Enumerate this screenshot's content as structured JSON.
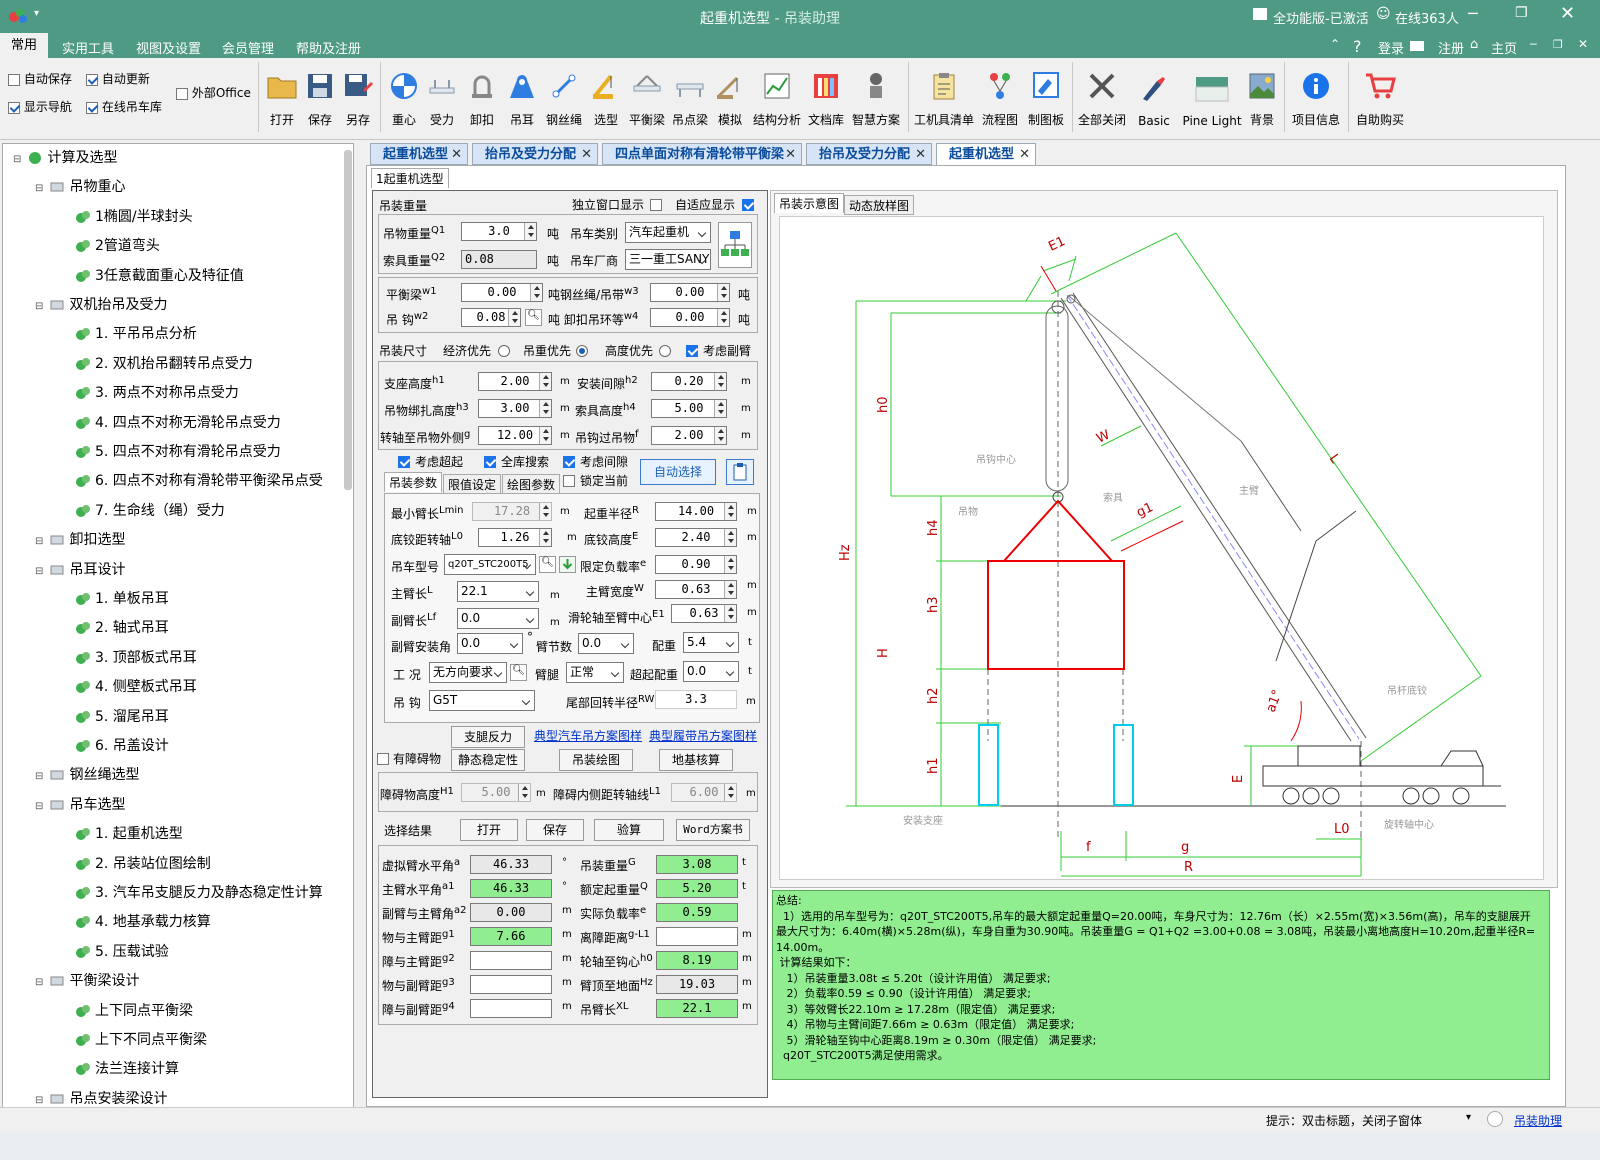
{
  "window": {
    "title_main": "起重机选型",
    "title_sep": " - ",
    "title_app": "吊装助理",
    "license": "全功能版-已激活",
    "online": "在线363人"
  },
  "menu": {
    "items": [
      "常用",
      "实用工具",
      "视图及设置",
      "会员管理",
      "帮助及注册"
    ],
    "login": "登录",
    "register": "注册",
    "home": "主页"
  },
  "ribbon": {
    "checks": [
      {
        "label": "自动保存",
        "checked": false
      },
      {
        "label": "自动更新",
        "checked": true
      },
      {
        "label": "外部Office",
        "checked": false
      },
      {
        "label": "显示导航",
        "checked": true
      },
      {
        "label": "在线吊车库",
        "checked": true
      }
    ],
    "buttons": [
      "打开",
      "保存",
      "另存",
      "重心",
      "受力",
      "卸扣",
      "吊耳",
      "钢丝绳",
      "选型",
      "平衡梁",
      "吊点梁",
      "模拟",
      "结构分析",
      "文档库",
      "智慧方案",
      "工机具清单",
      "流程图",
      "制图板",
      "全部关闭",
      "Basic",
      "Pine Light",
      "背景",
      "项目信息",
      "自助购买"
    ]
  },
  "tree": {
    "items": [
      {
        "label": "计算及选型",
        "level": 0
      },
      {
        "label": "吊物重心",
        "level": 1
      },
      {
        "label": "1椭圆/半球封头",
        "level": 2
      },
      {
        "label": "2管道弯头",
        "level": 2
      },
      {
        "label": "3任意截面重心及特征值",
        "level": 2
      },
      {
        "label": "双机抬吊及受力",
        "level": 1
      },
      {
        "label": "1. 平吊吊点分析",
        "level": 2
      },
      {
        "label": "2. 双机抬吊翻转吊点受力",
        "level": 2
      },
      {
        "label": "3. 两点不对称吊点受力",
        "level": 2
      },
      {
        "label": "4. 四点不对称无滑轮吊点受力",
        "level": 2
      },
      {
        "label": "5. 四点不对称有滑轮吊点受力",
        "level": 2
      },
      {
        "label": "6. 四点不对称有滑轮带平衡梁吊点受",
        "level": 2
      },
      {
        "label": "7. 生命线（绳）受力",
        "level": 2
      },
      {
        "label": "卸扣选型",
        "level": 1
      },
      {
        "label": "吊耳设计",
        "level": 1
      },
      {
        "label": "1. 单板吊耳",
        "level": 2
      },
      {
        "label": "2. 轴式吊耳",
        "level": 2
      },
      {
        "label": "3. 顶部板式吊耳",
        "level": 2
      },
      {
        "label": "4. 侧壁板式吊耳",
        "level": 2
      },
      {
        "label": "5. 溜尾吊耳",
        "level": 2
      },
      {
        "label": "6. 吊盖设计",
        "level": 2
      },
      {
        "label": "钢丝绳选型",
        "level": 1
      },
      {
        "label": "吊车选型",
        "level": 1
      },
      {
        "label": "1. 起重机选型",
        "level": 2
      },
      {
        "label": "2. 吊装站位图绘制",
        "level": 2
      },
      {
        "label": "3. 汽车吊支腿反力及静态稳定性计算",
        "level": 2
      },
      {
        "label": "4. 地基承载力核算",
        "level": 2
      },
      {
        "label": "5. 压载试验",
        "level": 2
      },
      {
        "label": "平衡梁设计",
        "level": 1
      },
      {
        "label": "上下同点平衡梁",
        "level": 2
      },
      {
        "label": "上下不同点平衡梁",
        "level": 2
      },
      {
        "label": "法兰连接计算",
        "level": 2
      },
      {
        "label": "吊点安装梁设计",
        "level": 1
      }
    ]
  },
  "tabs": [
    {
      "label": "起重机选型"
    },
    {
      "label": "抬吊及受力分配"
    },
    {
      "label": "四点单面对称有滑轮带平衡梁"
    },
    {
      "label": "抬吊及受力分配"
    },
    {
      "label": "起重机选型"
    }
  ],
  "form": {
    "inner_tab": "1起重机选型",
    "g1": {
      "title": "吊装重量",
      "independent": "独立窗口显示",
      "adaptive": "自适应显示",
      "q1_label": "吊物重量",
      "q1_sub": "Q1",
      "q1": "3.0",
      "ton": "吨",
      "type_label": "吊车类别",
      "type": "汽车起重机",
      "q2_label": "索具重量",
      "q2_sub": "Q2",
      "q2": "0.08",
      "maker_label": "吊车厂商",
      "maker": "三一重工SANY",
      "w1_label": "平衡梁",
      "w1_sub": "w1",
      "w1": "0.00",
      "w3_label": "钢丝绳/吊带",
      "w3_sub": "w3",
      "w3": "0.00",
      "w2_label": "吊 钩",
      "w2_sub": "w2",
      "w2": "0.08",
      "w4_label": "卸扣吊环等",
      "w4_sub": "w4",
      "w4": "0.00"
    },
    "g2": {
      "title": "吊装尺寸",
      "opt1": "经济优先",
      "opt2": "吊重优先",
      "opt3": "高度优先",
      "jib": "考虑副臂",
      "h1_label": "支座高度",
      "h1_sub": "h1",
      "h1": "2.00",
      "h2_label": "安装间隙",
      "h2_sub": "h2",
      "h2": "0.20",
      "h3_label": "吊物绑扎高度",
      "h3_sub": "h3",
      "h3": "3.00",
      "h4_label": "索具高度",
      "h4_sub": "h4",
      "h4": "5.00",
      "g_label": "转轴至吊物外侧",
      "g_sub": "g",
      "g": "12.00",
      "f_label": "吊钩过吊物",
      "f_sub": "f",
      "f": "2.00",
      "m": "m"
    },
    "options": {
      "c1": "考虑超起",
      "c2": "全库搜索",
      "c3": "考虑间隙",
      "c4": "锁定当前",
      "auto": "自动选择"
    },
    "subtabs": [
      "吊装参数",
      "限值设定",
      "绘图参数"
    ],
    "g3": {
      "lmin_label": "最小臂长",
      "lmin_sub": "Lmin",
      "lmin": "17.28",
      "r_label": "起重半径",
      "r_sub": "R",
      "r": "14.00",
      "l0_label": "底铰距转轴",
      "l0_sub": "L0",
      "l0": "1.26",
      "e_label": "底铰高度",
      "e_sub": "E",
      "e": "2.40",
      "model_label": "吊车型号",
      "model": "q20T_STC200T5",
      "rate_label": "限定负载率",
      "rate_sub": "e",
      "rate": "0.90",
      "l_label": "主臂长",
      "l_sub": "L",
      "l": "22.1",
      "w_label": "主臂宽度",
      "w_sub": "W",
      "w": "0.63",
      "lf_label": "副臂长",
      "lf_sub": "Lf",
      "lf": "0.0",
      "e1_label": "滑轮轴至臂中心",
      "e1_sub": "E1",
      "e1": "0.63",
      "ang_label": "副臂安装角",
      "ang": "0.0",
      "deg": "°",
      "seg_label": "臂节数",
      "seg": "0.0",
      "cw_label": "配重",
      "cw": "5.4",
      "t": "t",
      "cond_label": "工 况",
      "cond": "无方向要求",
      "leg_label": "臂腿",
      "leg": "正常",
      "scw_label": "超起配重",
      "scw": "0.0",
      "hook_label": "吊 钩",
      "hook": "G5T",
      "rw_label": "尾部回转半径",
      "rw_sub": "RW",
      "rw": "3.3"
    },
    "actions": {
      "outrigger": "支腿反力",
      "link1": "典型汽车吊方案图样",
      "link2": "典型履带吊方案图样",
      "obstacle": "有障碍物",
      "static": "静态稳定性",
      "drawing": "吊装绘图",
      "ground": "地基核算"
    },
    "g4": {
      "h1_label": "障碍物高度",
      "h1_sub": "H1",
      "h1": "5.00",
      "l1_label": "障碍内侧距转轴线",
      "l1_sub": "L1",
      "l1": "6.00"
    },
    "results_bar": {
      "label": "选择结果",
      "open": "打开",
      "save": "保存",
      "calc": "验算",
      "word": "Word方案书"
    },
    "results": {
      "a_label": "虚拟臂水平角",
      "a_sub": "a",
      "a": "46.33",
      "G_label": "吊装重量",
      "G_sub": "G",
      "G": "3.08",
      "a1_label": "主臂水平角",
      "a1_sub": "a1",
      "a1": "46.33",
      "Q_label": "额定起重量",
      "Q_sub": "Q",
      "Q": "5.20",
      "a2_label": "副臂与主臂角",
      "a2_sub": "a2",
      "a2": "0.00",
      "er_label": "实际负载率",
      "er_sub": "e",
      "er": "0.59",
      "g1_label": "物与主臂距",
      "g1_sub": "g1",
      "g1": "7.66",
      "gl1_label": "离障距离",
      "gl1_sub": "g-L1",
      "gl1": "",
      "g2_label": "障与主臂距",
      "g2_sub": "g2",
      "g2": "",
      "h0_label": "轮轴至钩心",
      "h0_sub": "h0",
      "h0": "8.19",
      "g3_label": "物与副臂距",
      "g3_sub": "g3",
      "g3": "",
      "hz_label": "臂顶至地面",
      "hz_sub": "Hz",
      "hz": "19.03",
      "g4_label": "障与副臂距",
      "g4_sub": "g4",
      "g4": "",
      "xl_label": "吊臂长",
      "xl_sub": "XL",
      "xl": "22.1",
      "deg": "°",
      "m": "m",
      "t": "t"
    }
  },
  "diagram": {
    "tabs": [
      "吊装示意图",
      "动态放样图"
    ],
    "labels": {
      "E1": "E1",
      "h0": "h0",
      "W": "W",
      "L": "L",
      "g1": "g1",
      "Hz": "Hz",
      "H": "H",
      "h1": "h1",
      "h2": "h2",
      "h3": "h3",
      "h4": "h4",
      "E": "E",
      "f": "f",
      "g": "g",
      "R": "R",
      "L0": "L0",
      "a1": "a1°",
      "hook_center": "吊钩中心",
      "rigging": "索具",
      "load": "吊物",
      "boom": "主臂",
      "boom_hinge": "吊杆底铰",
      "support": "安装支座",
      "slew": "旋转轴中心"
    }
  },
  "summary": {
    "lines": [
      "总结:",
      "  1）选用的吊车型号为：q20T_STC200T5,吊车的最大额定起重量Q=20.00吨，车身尺寸为：12.76m（长）×2.55m(宽)×3.56m(高)，吊车的支腿展开",
      "最大尺寸为：6.40m(横)×5.28m(纵)，车身自重为30.90吨。吊装重量G = Q1+Q2 =3.00+0.08 = 3.08吨，吊装最小离地高度H=10.20m,起重半径R=",
      "14.00m。",
      " 计算结果如下：",
      "   1）吊装重量3.08t ≤ 5.20t（设计许用值） 满足要求;",
      "   2）负载率0.59 ≤ 0.90（设计许用值） 满足要求;",
      "   3）等效臂长22.10m ≥ 17.28m（限定值） 满足要求;",
      "   4）吊物与主臂间距7.66m ≥ 0.63m（限定值） 满足要求;",
      "   5）滑轮轴至钩中心距离8.19m ≥ 0.30m（限定值） 满足要求;",
      "  q20T_STC200T5满足使用需求。"
    ]
  },
  "status": {
    "hint": "提示：双击标题，关闭子窗体",
    "app_link": "吊装助理"
  },
  "colors": {
    "title_bg": "#4f9a84",
    "summary_bg": "#90ee90",
    "green_field": "#90ee90",
    "link": "#0033cc"
  }
}
